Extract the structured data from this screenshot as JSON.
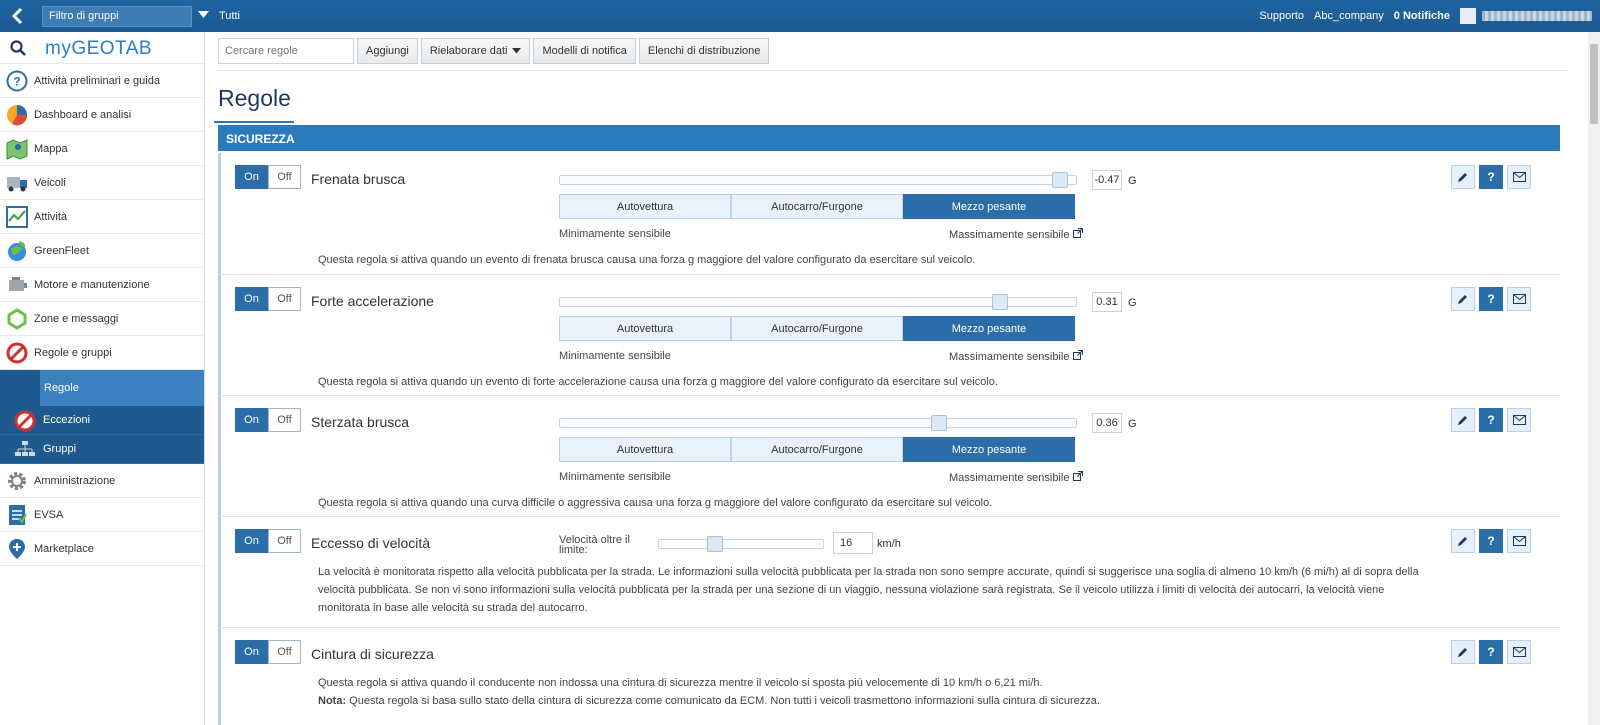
{
  "topbar": {
    "group_filter_label": "Filtro di gruppi",
    "group_value": "Tutti",
    "support": "Supporto",
    "company": "Abc_company",
    "notifications": "0 Notifiche"
  },
  "sidebar": {
    "logo": "myGEOTAB",
    "items": [
      {
        "label": "Attività preliminari e guida",
        "icon": "help-circle-icon"
      },
      {
        "label": "Dashboard e analisi",
        "icon": "pie-chart-icon"
      },
      {
        "label": "Mappa",
        "icon": "map-icon"
      },
      {
        "label": "Veicoli",
        "icon": "truck-icon"
      },
      {
        "label": "Attività",
        "icon": "activity-chart-icon"
      },
      {
        "label": "GreenFleet",
        "icon": "globe-leaf-icon"
      },
      {
        "label": "Motore e manutenzione",
        "icon": "engine-icon"
      },
      {
        "label": "Zone e messaggi",
        "icon": "zone-icon"
      },
      {
        "label": "Regole e gruppi",
        "icon": "prohibited-icon"
      }
    ],
    "subitems": [
      {
        "label": "Regole",
        "active": true
      },
      {
        "label": "Eccezioni",
        "icon": "prohibited-icon"
      },
      {
        "label": "Gruppi",
        "icon": "org-chart-icon"
      }
    ],
    "items_after": [
      {
        "label": "Amministrazione",
        "icon": "gear-icon"
      },
      {
        "label": "EVSA",
        "icon": "evsa-icon"
      },
      {
        "label": "Marketplace",
        "icon": "marketplace-icon"
      }
    ]
  },
  "toolbar": {
    "search_placeholder": "Cercare regole",
    "add": "Aggiungi",
    "reprocess": "Rielaborare dati",
    "templates": "Modelli di notifica",
    "distribution": "Elenchi di distribuzione"
  },
  "page_title": "Regole",
  "section_title": "SICUREZZA",
  "common": {
    "on": "On",
    "off": "Off",
    "seg_car": "Autovettura",
    "seg_van": "Autocarro/Furgone",
    "seg_heavy": "Mezzo pesante",
    "min_sens": "Minimamente sensibile",
    "max_sens": "Massimamente sensibile",
    "unit_g": "G"
  },
  "rules": [
    {
      "name": "Frenata brusca",
      "value": "-0.47",
      "slider_fraction": 0.98,
      "desc": "Questa regola si attiva quando un evento di frenata brusca causa una forza g maggiore del valore configurato da esercitare sul veicolo."
    },
    {
      "name": "Forte accelerazione",
      "value": "0.31",
      "slider_fraction": 0.86,
      "desc": "Questa regola si attiva quando un evento di forte accelerazione causa una forza g maggiore del valore configurato da esercitare sul veicolo."
    },
    {
      "name": "Sterzata brusca",
      "value": "0.36",
      "slider_fraction": 0.74,
      "desc": "Questa regola si attiva quando una curva difficile o aggressiva causa una forza g maggiore del valore configurato da esercitare sul veicolo."
    }
  ],
  "speeding": {
    "name": "Eccesso di velocità",
    "label": "Velocità oltre il limite:",
    "value": "16",
    "unit": "km/h",
    "slider_fraction": 0.32,
    "desc1": "La velocità è monitorata rispetto alla velocità pubblicata per la strada. Le informazioni sulla velocità pubblicata per la strada non sono sempre accurate, quindi si suggerisce una soglia di almeno 10 km/h (6 mi/h) al di sopra della velocità pubblicata. Se non vi sono informazioni sulla velocità pubblicata per la strada per una sezione di un viaggio, nessuna violazione sarà registrata. Se il veicolo utilizza i limiti di velocità dei autocarri, la velocità viene monitorata in base alle velocità su strada del autocarro."
  },
  "seatbelt": {
    "name": "Cintura di sicurezza",
    "desc": "Questa regola si attiva quando il conducente non indossa una cintura di sicurezza mentre il veicolo si sposta più velocemente di 10 km/h o 6,21 mi/h.",
    "note_label": "Nota:",
    "note": " Questa regola si basa sullo stato della cintura di sicurezza come comunicato da ECM. Non tutti i veicoli trasmettono informazioni sulla cintura di sicurezza."
  }
}
